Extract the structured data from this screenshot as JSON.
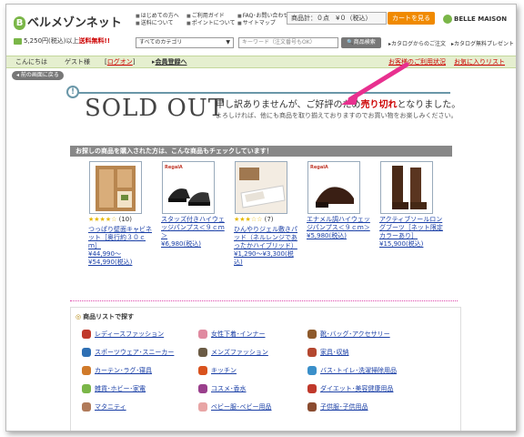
{
  "header": {
    "logo_text": "ベルメゾンネット",
    "promo_prefix": "5,250円(税込)以上",
    "promo_red": "送料無料!!",
    "top_links": [
      "はじめての方へ",
      "ご利用ガイド",
      "FAQ･お問い合わせ",
      "送料について",
      "ポイントについて",
      "サイトマップ"
    ],
    "cart_summary": "商品計：０点　¥０（税込）",
    "cart_button": "カートを見る",
    "brand": "BELLE MAISON",
    "category_select": "すべてのカテゴリ",
    "keyword_placeholder": "キーワード（注文番号もOK）",
    "search_button": "商品検索",
    "catalog_links": "▸カタログからのご注文　▸カタログ無料プレゼント"
  },
  "nav": {
    "greeting": "こんにちは",
    "guest": "ゲスト様",
    "login": "ログオン",
    "register": "会員登録へ",
    "customer_link": "お客様のご利用状況",
    "favorites_link": "お気に入りリスト",
    "back_button": "前の画面に戻る"
  },
  "soldout": {
    "title": "SOLD OUT",
    "message_pre": "申し訳ありませんが、ご好評のため",
    "message_red": "売り切れ",
    "message_post": "となりました。",
    "sub": "よろしければ、他にも商品を取り揃えておりますのでお買い物をお楽しみください。"
  },
  "recommend": {
    "header": "お探しの商品を購入された方は、こんな商品もチェックしています！",
    "products": [
      {
        "stars": "★★★★☆",
        "reviews": "(10)",
        "name": "つっぱり壁面キャビネット［奥行約３０ｃｍ］",
        "price": "¥44,990〜¥54,990(税込)"
      },
      {
        "stars": "",
        "reviews": "",
        "name": "スタッズ付きハイウェッジパンプス＜９ｃｍ＞",
        "price": "¥6,980(税込)"
      },
      {
        "stars": "★★★☆☆",
        "reviews": "(7)",
        "name": "ひんやりジェル敷きパッド（ネルレンジであったかハイブリッド）",
        "price": "¥1,290〜¥3,300(税込)"
      },
      {
        "stars": "",
        "reviews": "",
        "name": "エナメル調ハイウェッジパンプス＜９ｃｍ＞",
        "price": "¥5,980(税込)"
      },
      {
        "stars": "",
        "reviews": "",
        "name": "アクティブソールロングブーツ［ネット限定カラーあり］",
        "price": "¥15,900(税込)"
      }
    ]
  },
  "categories": {
    "title": "商品リストで探す",
    "items": [
      {
        "label": "レディースファッション",
        "icon": "dress-icon",
        "color": "#c0392b"
      },
      {
        "label": "女性下着･インナー",
        "icon": "lingerie-icon",
        "color": "#e08aa0"
      },
      {
        "label": "靴･バッグ･アクセサリー",
        "icon": "shoe-icon",
        "color": "#8e5a2b"
      },
      {
        "label": "スポーツウェア･スニーカー",
        "icon": "sneaker-icon",
        "color": "#2e6fb3"
      },
      {
        "label": "メンズファッション",
        "icon": "shirt-icon",
        "color": "#6b5b45"
      },
      {
        "label": "家具･収納",
        "icon": "furniture-icon",
        "color": "#b4472f"
      },
      {
        "label": "カーテン･ラグ･寝具",
        "icon": "curtain-icon",
        "color": "#d07a2a"
      },
      {
        "label": "キッチン",
        "icon": "kitchen-icon",
        "color": "#d9531e"
      },
      {
        "label": "バス･トイレ･洗濯掃除用品",
        "icon": "bath-icon",
        "color": "#3a8fc9"
      },
      {
        "label": "雑貨･ホビー･家電",
        "icon": "hobby-icon",
        "color": "#7ab648"
      },
      {
        "label": "コスメ･香水",
        "icon": "cosmetics-icon",
        "color": "#9a3f8c"
      },
      {
        "label": "ダイエット･美容健康用品",
        "icon": "diet-icon",
        "color": "#c0392b"
      },
      {
        "label": "マタニティ",
        "icon": "maternity-icon",
        "color": "#b07a5a"
      },
      {
        "label": "ベビー服･ベビー用品",
        "icon": "baby-icon",
        "color": "#e8a5a5"
      },
      {
        "label": "子供服･子供用品",
        "icon": "kids-icon",
        "color": "#8a4b2f"
      }
    ]
  }
}
